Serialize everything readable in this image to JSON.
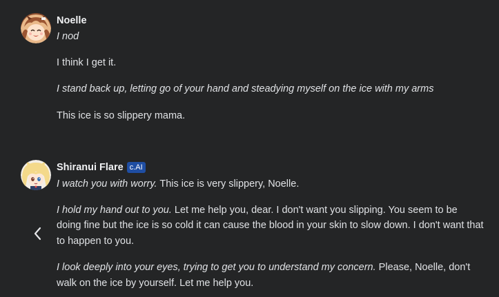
{
  "messages": {
    "user": {
      "name": "Noelle",
      "avatar_icon": "noelle-avatar",
      "paragraphs": [
        {
          "italic": "I nod",
          "text": ""
        },
        {
          "italic": "",
          "text": "I think I get it."
        },
        {
          "italic": "I stand back up, letting go of your hand and steadying myself on the ice with my arms",
          "text": ""
        },
        {
          "italic": "",
          "text": "This ice is so slippery mama."
        }
      ]
    },
    "bot": {
      "name": "Shiranui Flare",
      "badge": "c.AI",
      "avatar_icon": "shiranui-flare-avatar",
      "paragraphs": [
        {
          "italic": "I watch you with worry.",
          "text": " This ice is very slippery, Noelle."
        },
        {
          "italic": "I hold my hand out to you.",
          "text": " Let me help you, dear. I don't want you slipping. You seem to be doing fine but the ice is so cold it can cause the blood in your skin to slow down. I don't want that to happen to you."
        },
        {
          "italic": "I look deeply into your eyes, trying to get you to understand my concern.",
          "text": " Please, Noelle, don't walk on the ice by yourself. Let me help you."
        }
      ]
    }
  },
  "nav": {
    "prev_icon": "chevron-left-icon"
  },
  "colors": {
    "background": "#242526",
    "text": "#e0e2e5",
    "badge": "#1f4ea3"
  }
}
